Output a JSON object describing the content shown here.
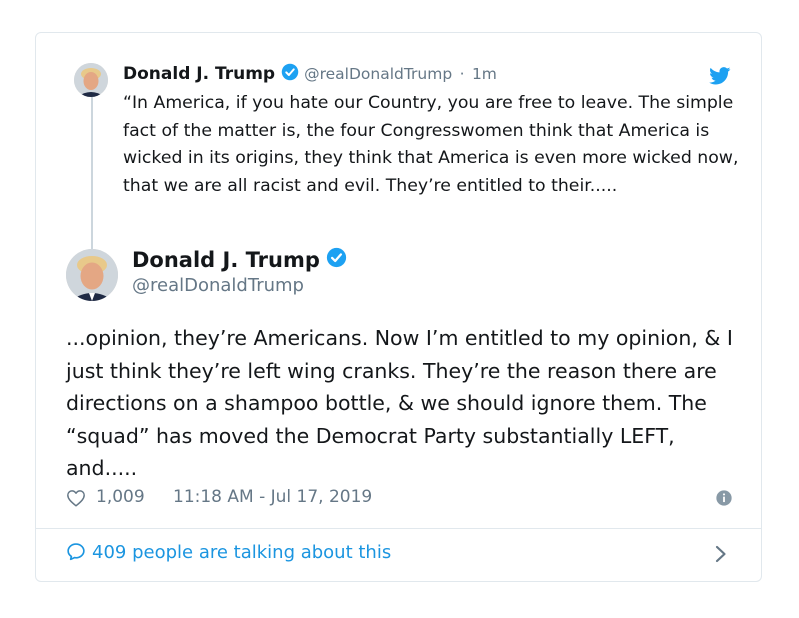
{
  "quoted_tweet": {
    "display_name": "Donald J. Trump",
    "handle": "@realDonaldTrump",
    "separator": "·",
    "time_ago": "1m",
    "text": "“In America, if you hate our Country, you are free to leave. The simple fact of the matter is, the four Congresswomen think that America is wicked in its origins, they think that America is even more wicked now, that we are all racist and evil. They’re entitled to their.....",
    "icons": [
      "avatar",
      "verified-badge-icon",
      "twitter-bird-icon"
    ]
  },
  "main_tweet": {
    "display_name": "Donald J. Trump",
    "handle": "@realDonaldTrump",
    "text": "...opinion, they’re Americans. Now I’m entitled to my opinion, & I just think they’re left wing cranks. They’re the reason there are directions on a shampoo bottle, & we should ignore them. The “squad” has moved the Democrat Party substantially LEFT, and.....",
    "likes": "1,009",
    "timestamp": "11:18 AM - Jul 17, 2019",
    "icons": [
      "heart-icon",
      "info-icon"
    ]
  },
  "footer": {
    "talk_label": "409 people are talking about this",
    "icons": [
      "comment-bubble-icon",
      "chevron-right-icon"
    ]
  },
  "colors": {
    "link_blue": "#1b95e0",
    "verified_blue": "#1da1f2",
    "secondary_text": "#657786",
    "border": "#e1e8ed"
  }
}
